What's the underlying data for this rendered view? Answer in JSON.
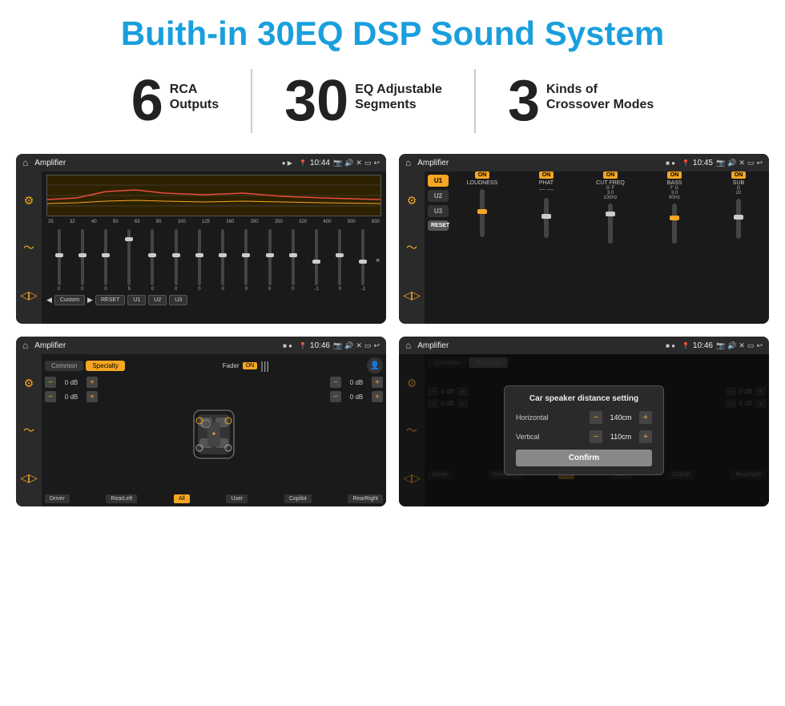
{
  "header": {
    "title": "Buith-in 30EQ DSP Sound System"
  },
  "stats": [
    {
      "number": "6",
      "label1": "RCA",
      "label2": "Outputs"
    },
    {
      "number": "30",
      "label1": "EQ Adjustable",
      "label2": "Segments"
    },
    {
      "number": "3",
      "label1": "Kinds of",
      "label2": "Crossover Modes"
    }
  ],
  "screens": {
    "eq": {
      "title": "Amplifier",
      "time": "10:44",
      "freq_labels": [
        "25",
        "32",
        "40",
        "50",
        "63",
        "80",
        "100",
        "125",
        "160",
        "200",
        "250",
        "320",
        "400",
        "500",
        "630"
      ],
      "slider_vals": [
        "0",
        "0",
        "0",
        "5",
        "0",
        "0",
        "0",
        "0",
        "0",
        "0",
        "0",
        "-1",
        "0",
        "-1"
      ],
      "bottom_btns": [
        "Custom",
        "RESET",
        "U1",
        "U2",
        "U3"
      ]
    },
    "amp": {
      "title": "Amplifier",
      "time": "10:45",
      "presets": [
        "U1",
        "U2",
        "U3"
      ],
      "controls": [
        "LOUDNESS",
        "PHAT",
        "CUT FREQ",
        "BASS",
        "SUB"
      ],
      "on_label": "ON"
    },
    "crossover": {
      "title": "Amplifier",
      "time": "10:46",
      "tabs": [
        "Common",
        "Specialty"
      ],
      "fader_label": "Fader",
      "on_label": "ON",
      "left_dbs": [
        "0 dB",
        "0 dB"
      ],
      "right_dbs": [
        "0 dB",
        "0 dB"
      ],
      "footer_btns": [
        "Driver",
        "RearLeft",
        "All",
        "User",
        "Copilot",
        "RearRight"
      ]
    },
    "dialog": {
      "title": "Amplifier",
      "time": "10:46",
      "dialog_title": "Car speaker distance setting",
      "horizontal_label": "Horizontal",
      "horizontal_value": "140cm",
      "vertical_label": "Vertical",
      "vertical_value": "110cm",
      "confirm_label": "Confirm",
      "left_dbs": [
        "0 dB",
        "0 dB"
      ],
      "right_dbs": [
        "0 dB",
        "0 dB"
      ]
    }
  }
}
